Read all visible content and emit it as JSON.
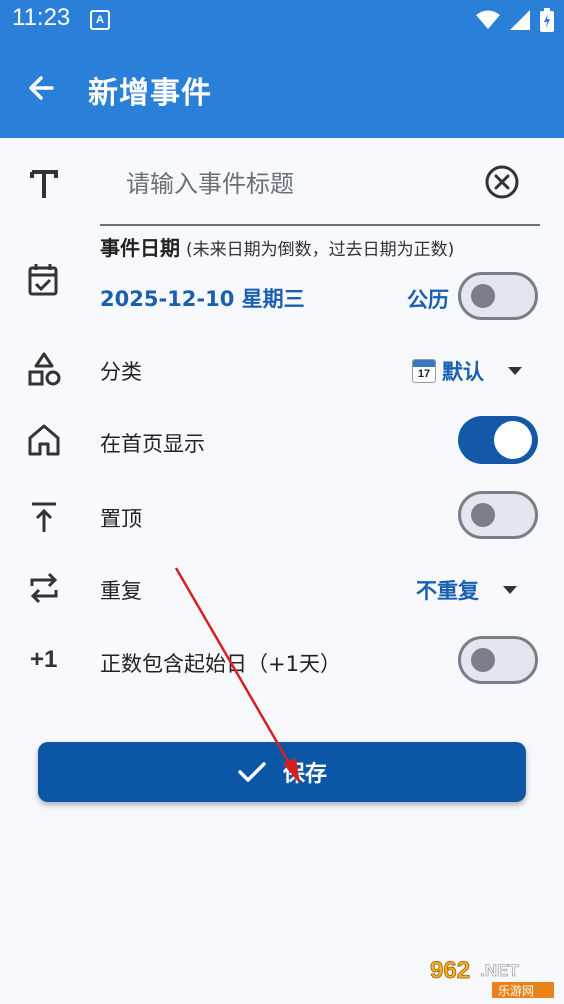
{
  "status_bar": {
    "time": "11:23",
    "badge": "A"
  },
  "app_bar": {
    "title": "新增事件"
  },
  "title_field": {
    "placeholder": "请输入事件标题",
    "value": ""
  },
  "date": {
    "label": "事件日期",
    "hint": "(未来日期为倒数，过去日期为正数)",
    "value": "2025-12-10 星期三",
    "calendar_type": "公历",
    "lunar_enabled": false
  },
  "category": {
    "label": "分类",
    "icon_number": "17",
    "value": "默认"
  },
  "show_on_home": {
    "label": "在首页显示",
    "enabled": true
  },
  "pin_top": {
    "label": "置顶",
    "enabled": false
  },
  "repeat": {
    "label": "重复",
    "value": "不重复"
  },
  "include_start": {
    "icon_text": "+1",
    "label": "正数包含起始日（+1天）",
    "enabled": false
  },
  "save_button": {
    "label": "保存"
  },
  "watermark": {
    "brand": "962",
    "suffix": ".NET",
    "sub": "乐游网"
  },
  "colors": {
    "primary": "#2a7fd9",
    "accent": "#1458a8",
    "annotation_arrow": "#d62020"
  }
}
